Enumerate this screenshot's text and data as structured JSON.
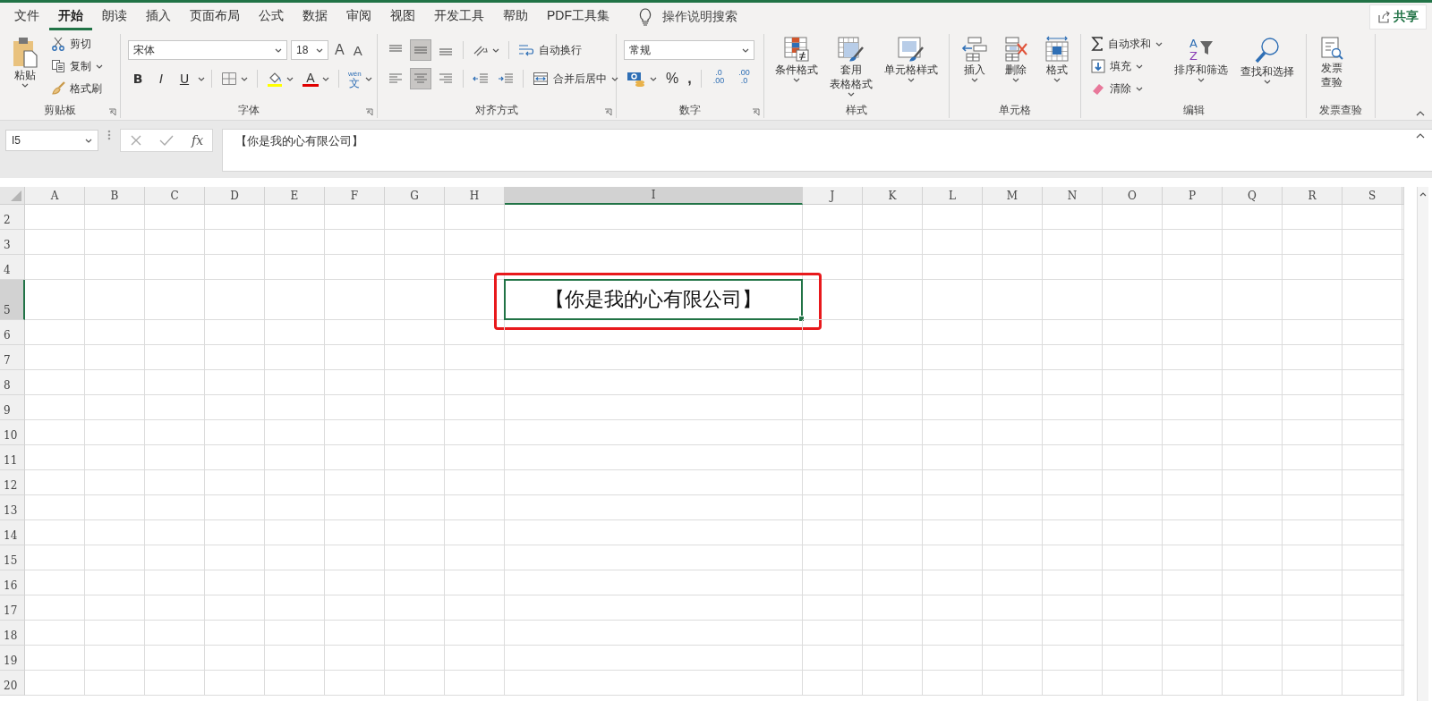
{
  "tabs": [
    {
      "label": "文件",
      "selected": false
    },
    {
      "label": "开始",
      "selected": true
    },
    {
      "label": "朗读",
      "selected": false
    },
    {
      "label": "插入",
      "selected": false
    },
    {
      "label": "页面布局",
      "selected": false
    },
    {
      "label": "公式",
      "selected": false
    },
    {
      "label": "数据",
      "selected": false
    },
    {
      "label": "审阅",
      "selected": false
    },
    {
      "label": "视图",
      "selected": false
    },
    {
      "label": "开发工具",
      "selected": false
    },
    {
      "label": "帮助",
      "selected": false
    },
    {
      "label": "PDF工具集",
      "selected": false
    }
  ],
  "tell_me": "操作说明搜索",
  "share": "共享",
  "ribbon": [
    {
      "kind": "clipboard",
      "label": "剪贴板",
      "launcher": true,
      "paste": "粘贴",
      "commands": [
        {
          "label": "剪切",
          "dropdown": false
        },
        {
          "label": "复制",
          "dropdown": true
        },
        {
          "label": "格式刷",
          "dropdown": false
        }
      ]
    },
    {
      "kind": "font",
      "label": "字体",
      "launcher": true,
      "font_name": "宋体",
      "font_size": "18",
      "grow": "A",
      "shrink": "A",
      "styles": [
        {
          "label": "B",
          "kind": "bold",
          "dropdown": false
        },
        {
          "label": "I",
          "kind": "italic",
          "dropdown": false
        },
        {
          "label": "U",
          "kind": "underline",
          "dropdown": true
        }
      ],
      "font_color": "A",
      "phonetic": {
        "top": "wén",
        "bottom": "文"
      }
    },
    {
      "kind": "alignment",
      "label": "对齐方式",
      "launcher": true,
      "vertical": [
        {
          "selected": false
        },
        {
          "selected": true
        },
        {
          "selected": false
        }
      ],
      "horizontal": [
        {
          "selected": false
        },
        {
          "selected": true
        },
        {
          "selected": false
        }
      ],
      "wrap": "自动换行",
      "merge": "合并后居中"
    },
    {
      "kind": "number",
      "label": "数字",
      "launcher": true,
      "format": "常规",
      "percent": "%",
      "comma": ",",
      "decimals": [
        {
          "top": ".0",
          "bottom": ".00"
        },
        {
          "top": ".00",
          "bottom": ".0"
        }
      ]
    },
    {
      "kind": "styles",
      "label": "样式",
      "launcher": false,
      "commands": [
        {
          "lines": [
            "条件格式"
          ],
          "dropdown": true
        },
        {
          "lines": [
            "套用",
            "表格格式"
          ],
          "dropdown": true
        },
        {
          "lines": [
            "单元格样式"
          ],
          "dropdown": true
        }
      ]
    },
    {
      "kind": "cells",
      "label": "单元格",
      "launcher": false,
      "commands": [
        {
          "lines": [
            "插入"
          ],
          "dropdown": true
        },
        {
          "lines": [
            "删除"
          ],
          "dropdown": true
        },
        {
          "lines": [
            "格式"
          ],
          "dropdown": true
        }
      ]
    },
    {
      "kind": "editing",
      "label": "编辑",
      "launcher": false,
      "commands": [
        {
          "label": "自动求和",
          "dropdown": true
        },
        {
          "label": "填充",
          "dropdown": true
        },
        {
          "label": "清除",
          "dropdown": true
        }
      ],
      "sort": {
        "lines": [
          "排序和筛选"
        ],
        "glyphs": [
          "A",
          "Z"
        ],
        "dropdown": true
      },
      "find": {
        "lines": [
          "查找和选择"
        ],
        "dropdown": true
      }
    },
    {
      "kind": "invoice",
      "label": "发票查验",
      "launcher": false,
      "commands": [
        {
          "lines": [
            "发票",
            "查验"
          ],
          "dropdown": false
        }
      ]
    }
  ],
  "formula_bar": {
    "name_box": "I5",
    "function_label": "fx",
    "content": "【你是我的心有限公司】"
  },
  "sheet": {
    "columns": [
      {
        "label": "A",
        "selected": false
      },
      {
        "label": "B",
        "selected": false
      },
      {
        "label": "C",
        "selected": false
      },
      {
        "label": "D",
        "selected": false
      },
      {
        "label": "E",
        "selected": false
      },
      {
        "label": "F",
        "selected": false
      },
      {
        "label": "G",
        "selected": false
      },
      {
        "label": "H",
        "selected": false
      },
      {
        "label": "I",
        "selected": true
      },
      {
        "label": "J",
        "selected": false
      },
      {
        "label": "K",
        "selected": false
      },
      {
        "label": "L",
        "selected": false
      },
      {
        "label": "M",
        "selected": false
      },
      {
        "label": "N",
        "selected": false
      },
      {
        "label": "O",
        "selected": false
      },
      {
        "label": "P",
        "selected": false
      },
      {
        "label": "Q",
        "selected": false
      },
      {
        "label": "R",
        "selected": false
      },
      {
        "label": "S",
        "selected": false
      }
    ],
    "rows": [
      {
        "label": "2",
        "selected": false
      },
      {
        "label": "3",
        "selected": false
      },
      {
        "label": "4",
        "selected": false
      },
      {
        "label": "5",
        "selected": true,
        "cells": [
          {
            "text": "【你是我的心有限公司】",
            "active": true,
            "marked": true
          }
        ]
      },
      {
        "label": "6",
        "selected": false
      },
      {
        "label": "7",
        "selected": false
      },
      {
        "label": "8",
        "selected": false
      },
      {
        "label": "9",
        "selected": false
      },
      {
        "label": "10",
        "selected": false
      },
      {
        "label": "11",
        "selected": false
      },
      {
        "label": "12",
        "selected": false
      },
      {
        "label": "13",
        "selected": false
      },
      {
        "label": "14",
        "selected": false
      },
      {
        "label": "15",
        "selected": false
      },
      {
        "label": "16",
        "selected": false
      },
      {
        "label": "17",
        "selected": false
      },
      {
        "label": "18",
        "selected": false
      },
      {
        "label": "19",
        "selected": false
      },
      {
        "label": "20",
        "selected": false
      }
    ]
  }
}
